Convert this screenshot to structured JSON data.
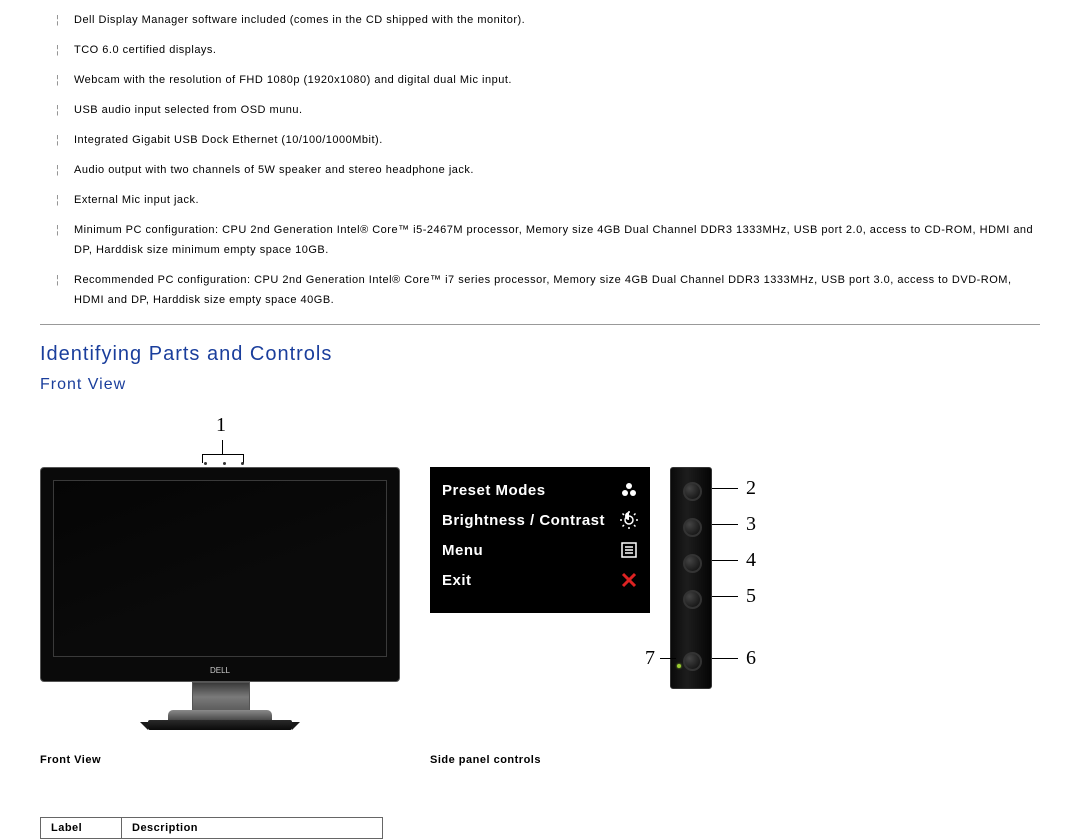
{
  "bullets": [
    "Dell Display Manager software included (comes in the CD shipped with the monitor).",
    "TCO 6.0 certified displays.",
    "Webcam with the resolution of FHD 1080p (1920x1080) and digital dual Mic input.",
    "USB audio input selected from OSD munu.",
    "Integrated Gigabit USB Dock Ethernet (10/100/1000Mbit).",
    "Audio output with two channels of 5W speaker and stereo headphone jack.",
    "External Mic input jack.",
    "Minimum PC configuration: CPU 2nd Generation Intel® Core™ i5-2467M processor, Memory size 4GB Dual Channel DDR3 1333MHz, USB port 2.0, access to CD-ROM, HDMI and DP, Harddisk size minimum empty space 10GB.",
    "Recommended PC configuration: CPU 2nd Generation Intel® Core™ i7 series processor, Memory size 4GB Dual Channel DDR3 1333MHz, USB port 3.0, access to DVD-ROM, HDMI and DP, Harddisk size empty space 40GB."
  ],
  "section_title": "Identifying Parts and Controls",
  "subsection_title": "Front View",
  "front_caption": "Front View",
  "side_caption": "Side panel controls",
  "monitor_logo": "DELL",
  "osd": {
    "preset": "Preset Modes",
    "brightness": "Brightness / Contrast",
    "menu": "Menu",
    "exit": "Exit"
  },
  "callouts": {
    "c1": "1",
    "c2": "2",
    "c3": "3",
    "c4": "4",
    "c5": "5",
    "c6": "6",
    "c7": "7"
  },
  "table": {
    "label_header": "Label",
    "desc_header": "Description"
  }
}
